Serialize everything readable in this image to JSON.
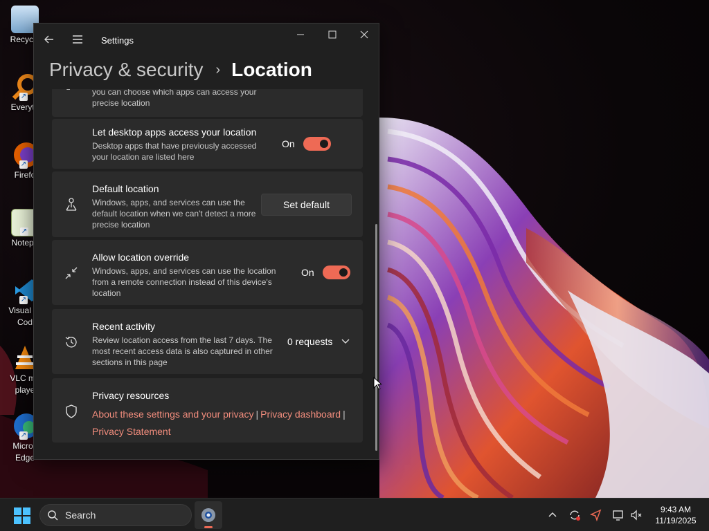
{
  "desktop": {
    "icons": [
      {
        "label": "Recycle",
        "icon": "recycle-bin-icon"
      },
      {
        "label": "Everyth",
        "icon": "everything-search-icon"
      },
      {
        "label": "Firefo",
        "icon": "firefox-icon"
      },
      {
        "label": "Notepa",
        "icon": "notepad-icon"
      },
      {
        "label_line1": "Visual St",
        "label_line2": "Cod",
        "icon": "vscode-icon"
      },
      {
        "label_line1": "VLC me",
        "label_line2": "playe",
        "icon": "vlc-icon"
      },
      {
        "label_line1": "Micros",
        "label_line2": "Edge",
        "icon": "edge-icon"
      }
    ]
  },
  "window": {
    "title": "Settings",
    "breadcrumb": {
      "parent": "Privacy & security",
      "separator": "›",
      "current": "Location"
    },
    "cards": {
      "partial": {
        "desc_line1": "you can choose which apps can access your",
        "desc_line2": "precise location"
      },
      "desktop_apps": {
        "title": "Let desktop apps access your location",
        "desc": "Desktop apps that have previously accessed your location are listed here",
        "toggle_label": "On"
      },
      "default_location": {
        "title": "Default location",
        "desc": "Windows, apps, and services can use the default location when we can't detect a more precise location",
        "button": "Set default"
      },
      "override": {
        "title": "Allow location override",
        "desc": "Windows, apps, and services can use the location from a remote connection instead of this device's location",
        "toggle_label": "On"
      },
      "recent_activity": {
        "title": "Recent activity",
        "desc": "Review location access from the last 7 days. The most recent access data is also captured in other sections in this page",
        "value": "0 requests"
      },
      "privacy_resources": {
        "title": "Privacy resources",
        "link1": "About these settings and your privacy",
        "link2": "Privacy dashboard",
        "link3": "Privacy Statement",
        "separator": "|"
      }
    }
  },
  "taskbar": {
    "search_placeholder": "Search",
    "time": "9:43 AM",
    "date": "11/19/2025"
  },
  "colors": {
    "accent": "#ee6a55",
    "link": "#f28d7d",
    "card": "#2b2b2b",
    "window": "#202020"
  }
}
